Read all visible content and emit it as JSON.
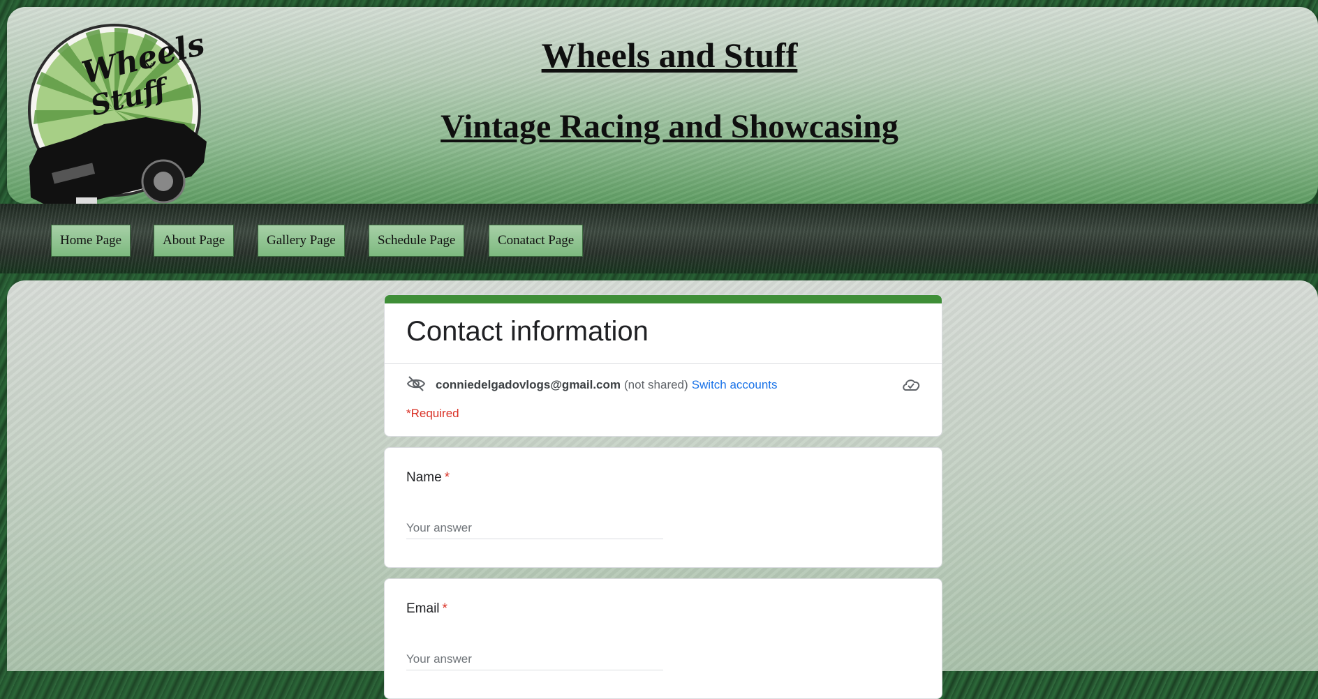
{
  "header": {
    "title": "Wheels and Stuff",
    "subtitle": "Vintage Racing and Showcasing",
    "logo_text": "Wheels & Stuff"
  },
  "nav": {
    "items": [
      {
        "label": "Home Page"
      },
      {
        "label": "About Page"
      },
      {
        "label": "Gallery Page"
      },
      {
        "label": "Schedule Page"
      },
      {
        "label": "Conatact Page"
      }
    ]
  },
  "form": {
    "title": "Contact information",
    "account": {
      "email": "conniedelgadovlogs@gmail.com",
      "not_shared": "(not shared)",
      "switch_label": "Switch accounts",
      "icon_hidden": "eye-off-icon",
      "icon_cloud": "cloud-check-icon"
    },
    "required_note": "*Required",
    "questions": [
      {
        "label": "Name",
        "required_mark": "*",
        "placeholder": "Your answer"
      },
      {
        "label": "Email",
        "required_mark": "*",
        "placeholder": "Your answer"
      }
    ],
    "accent_color": "#3e8e37",
    "link_color": "#1a73e8",
    "required_color": "#d93025"
  }
}
